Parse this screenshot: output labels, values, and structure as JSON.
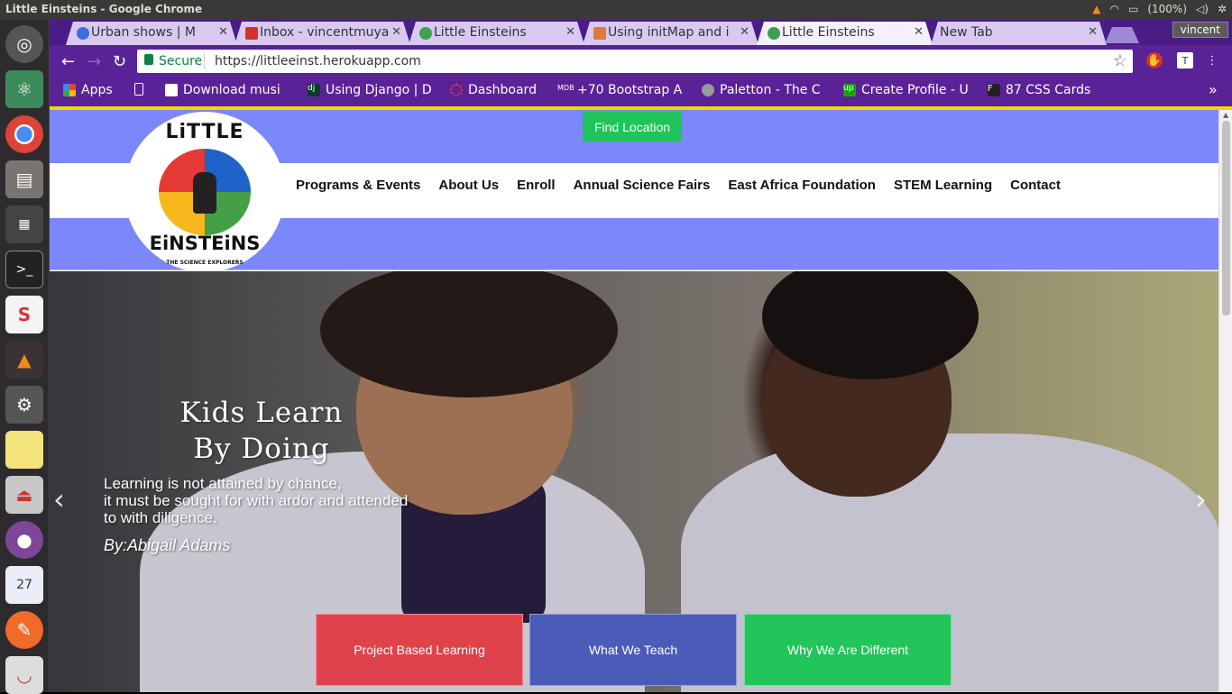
{
  "system_bar": {
    "window_title": "Little Einsteins - Google Chrome",
    "battery": "(100%)"
  },
  "launcher": {
    "calendar_day": "27"
  },
  "browser": {
    "tabs": [
      {
        "label": "Urban shows | M",
        "active": false
      },
      {
        "label": "Inbox - vincentmuya",
        "active": false
      },
      {
        "label": "Little Einsteins",
        "active": false
      },
      {
        "label": "Using initMap and i",
        "active": false
      },
      {
        "label": "Little Einsteins",
        "active": true
      },
      {
        "label": "New Tab",
        "active": false
      }
    ],
    "user": "vincent",
    "secure_label": "Secure",
    "url": "https://littleeinst.herokuapp.com",
    "bookmarks": [
      {
        "label": "Apps"
      },
      {
        "label": "Download musi"
      },
      {
        "label": "Using Django | D"
      },
      {
        "label": "Dashboard"
      },
      {
        "label": "+70 Bootstrap A"
      },
      {
        "label": "Paletton - The C"
      },
      {
        "label": "Create Profile - U"
      },
      {
        "label": "87 CSS Cards"
      }
    ],
    "bookmarks_overflow": "»"
  },
  "site": {
    "find_location_label": "Find Location",
    "logo": {
      "top_text": "LiTTLE",
      "bottom_text": "EiNSTEiNS",
      "tagline": "THE SCIENCE EXPLORERS"
    },
    "nav": [
      {
        "label": "Programs & Events"
      },
      {
        "label": "About Us"
      },
      {
        "label": "Enroll"
      },
      {
        "label": "Annual Science Fairs"
      },
      {
        "label": "East Africa Foundation"
      },
      {
        "label": "STEM Learning"
      },
      {
        "label": "Contact"
      }
    ],
    "hero": {
      "heading_line1": "Kids Learn",
      "heading_line2": "By Doing",
      "quote_line1": "Learning is not attained by chance,",
      "quote_line2": "it must be sought for with ardor and attended",
      "quote_line3": "to with diligence.",
      "author": "By:Abigail Adams",
      "prev_arrow": "‹",
      "next_arrow": "›"
    },
    "cta_buttons": [
      {
        "label": "Project Based Learning",
        "color": "#e0424c"
      },
      {
        "label": "What We Teach",
        "color": "#4a5bb8"
      },
      {
        "label": "Why We Are Different",
        "color": "#22c55a"
      }
    ]
  },
  "colors": {
    "browser_theme": "#5a2297",
    "nav_band": "#7b87fb",
    "accent_yellow": "#f0d800",
    "find_button": "#21c45a"
  }
}
